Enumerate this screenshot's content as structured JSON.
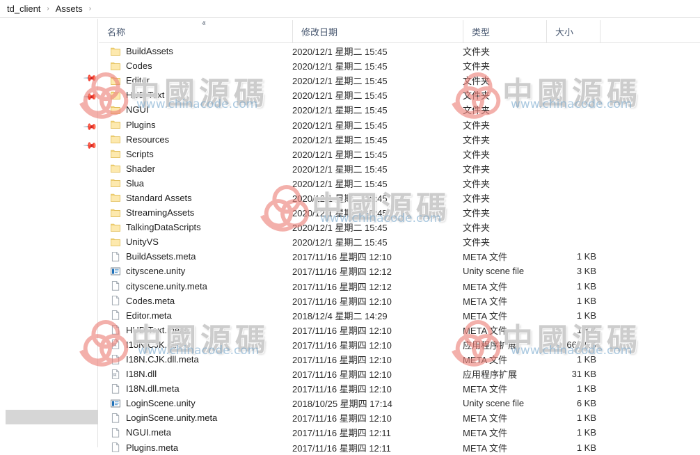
{
  "breadcrumb": {
    "items": [
      "td_client",
      "Assets"
    ],
    "separator": "›"
  },
  "columns": {
    "name": "名称",
    "date": "修改日期",
    "type": "类型",
    "size": "大小",
    "sort_caret": "ⱏ"
  },
  "nav": {
    "pin_icon": "📌",
    "pin_count": 4
  },
  "watermark": {
    "text_cn": "中國源碼",
    "url": "www.chinacode.com",
    "logo_color": "#ec8079"
  },
  "files": [
    {
      "name": "BuildAssets",
      "icon": "folder-icon",
      "date": "2020/12/1 星期二 15:45",
      "type": "文件夹",
      "size": ""
    },
    {
      "name": "Codes",
      "icon": "folder-icon",
      "date": "2020/12/1 星期二 15:45",
      "type": "文件夹",
      "size": ""
    },
    {
      "name": "Editor",
      "icon": "folder-icon",
      "date": "2020/12/1 星期二 15:45",
      "type": "文件夹",
      "size": ""
    },
    {
      "name": "HUD Text",
      "icon": "folder-icon",
      "date": "2020/12/1 星期二 15:45",
      "type": "文件夹",
      "size": ""
    },
    {
      "name": "NGUI",
      "icon": "folder-icon",
      "date": "2020/12/1 星期二 15:45",
      "type": "文件夹",
      "size": ""
    },
    {
      "name": "Plugins",
      "icon": "folder-icon",
      "date": "2020/12/1 星期二 15:45",
      "type": "文件夹",
      "size": ""
    },
    {
      "name": "Resources",
      "icon": "folder-icon",
      "date": "2020/12/1 星期二 15:45",
      "type": "文件夹",
      "size": ""
    },
    {
      "name": "Scripts",
      "icon": "folder-icon",
      "date": "2020/12/1 星期二 15:45",
      "type": "文件夹",
      "size": ""
    },
    {
      "name": "Shader",
      "icon": "folder-icon",
      "date": "2020/12/1 星期二 15:45",
      "type": "文件夹",
      "size": ""
    },
    {
      "name": "Slua",
      "icon": "folder-icon",
      "date": "2020/12/1 星期二 15:45",
      "type": "文件夹",
      "size": ""
    },
    {
      "name": "Standard Assets",
      "icon": "folder-icon",
      "date": "2020/12/1 星期二 15:45",
      "type": "文件夹",
      "size": ""
    },
    {
      "name": "StreamingAssets",
      "icon": "folder-icon",
      "date": "2020/12/1 星期二 15:45",
      "type": "文件夹",
      "size": ""
    },
    {
      "name": "TalkingDataScripts",
      "icon": "folder-icon",
      "date": "2020/12/1 星期二 15:45",
      "type": "文件夹",
      "size": ""
    },
    {
      "name": "UnityVS",
      "icon": "folder-icon",
      "date": "2020/12/1 星期二 15:45",
      "type": "文件夹",
      "size": ""
    },
    {
      "name": "BuildAssets.meta",
      "icon": "file-icon",
      "date": "2017/11/16 星期四 12:10",
      "type": "META 文件",
      "size": "1 KB"
    },
    {
      "name": "cityscene.unity",
      "icon": "unity-scene-icon",
      "date": "2017/11/16 星期四 12:12",
      "type": "Unity scene file",
      "size": "3 KB"
    },
    {
      "name": "cityscene.unity.meta",
      "icon": "file-icon",
      "date": "2017/11/16 星期四 12:12",
      "type": "META 文件",
      "size": "1 KB"
    },
    {
      "name": "Codes.meta",
      "icon": "file-icon",
      "date": "2017/11/16 星期四 12:10",
      "type": "META 文件",
      "size": "1 KB"
    },
    {
      "name": "Editor.meta",
      "icon": "file-icon",
      "date": "2018/12/4 星期二 14:29",
      "type": "META 文件",
      "size": "1 KB"
    },
    {
      "name": "HUD Text.meta",
      "icon": "file-icon",
      "date": "2017/11/16 星期四 12:10",
      "type": "META 文件",
      "size": "1 KB"
    },
    {
      "name": "I18N.CJK.dll",
      "icon": "dll-icon",
      "date": "2017/11/16 星期四 12:10",
      "type": "应用程序扩展",
      "size": "665 KB"
    },
    {
      "name": "I18N.CJK.dll.meta",
      "icon": "file-icon",
      "date": "2017/11/16 星期四 12:10",
      "type": "META 文件",
      "size": "1 KB"
    },
    {
      "name": "I18N.dll",
      "icon": "dll-icon",
      "date": "2017/11/16 星期四 12:10",
      "type": "应用程序扩展",
      "size": "31 KB"
    },
    {
      "name": "I18N.dll.meta",
      "icon": "file-icon",
      "date": "2017/11/16 星期四 12:10",
      "type": "META 文件",
      "size": "1 KB"
    },
    {
      "name": "LoginScene.unity",
      "icon": "unity-scene-icon",
      "date": "2018/10/25 星期四 17:14",
      "type": "Unity scene file",
      "size": "6 KB"
    },
    {
      "name": "LoginScene.unity.meta",
      "icon": "file-icon",
      "date": "2017/11/16 星期四 12:10",
      "type": "META 文件",
      "size": "1 KB"
    },
    {
      "name": "NGUI.meta",
      "icon": "file-icon",
      "date": "2017/11/16 星期四 12:11",
      "type": "META 文件",
      "size": "1 KB"
    },
    {
      "name": "Plugins.meta",
      "icon": "file-icon",
      "date": "2017/11/16 星期四 12:11",
      "type": "META 文件",
      "size": "1 KB"
    }
  ]
}
